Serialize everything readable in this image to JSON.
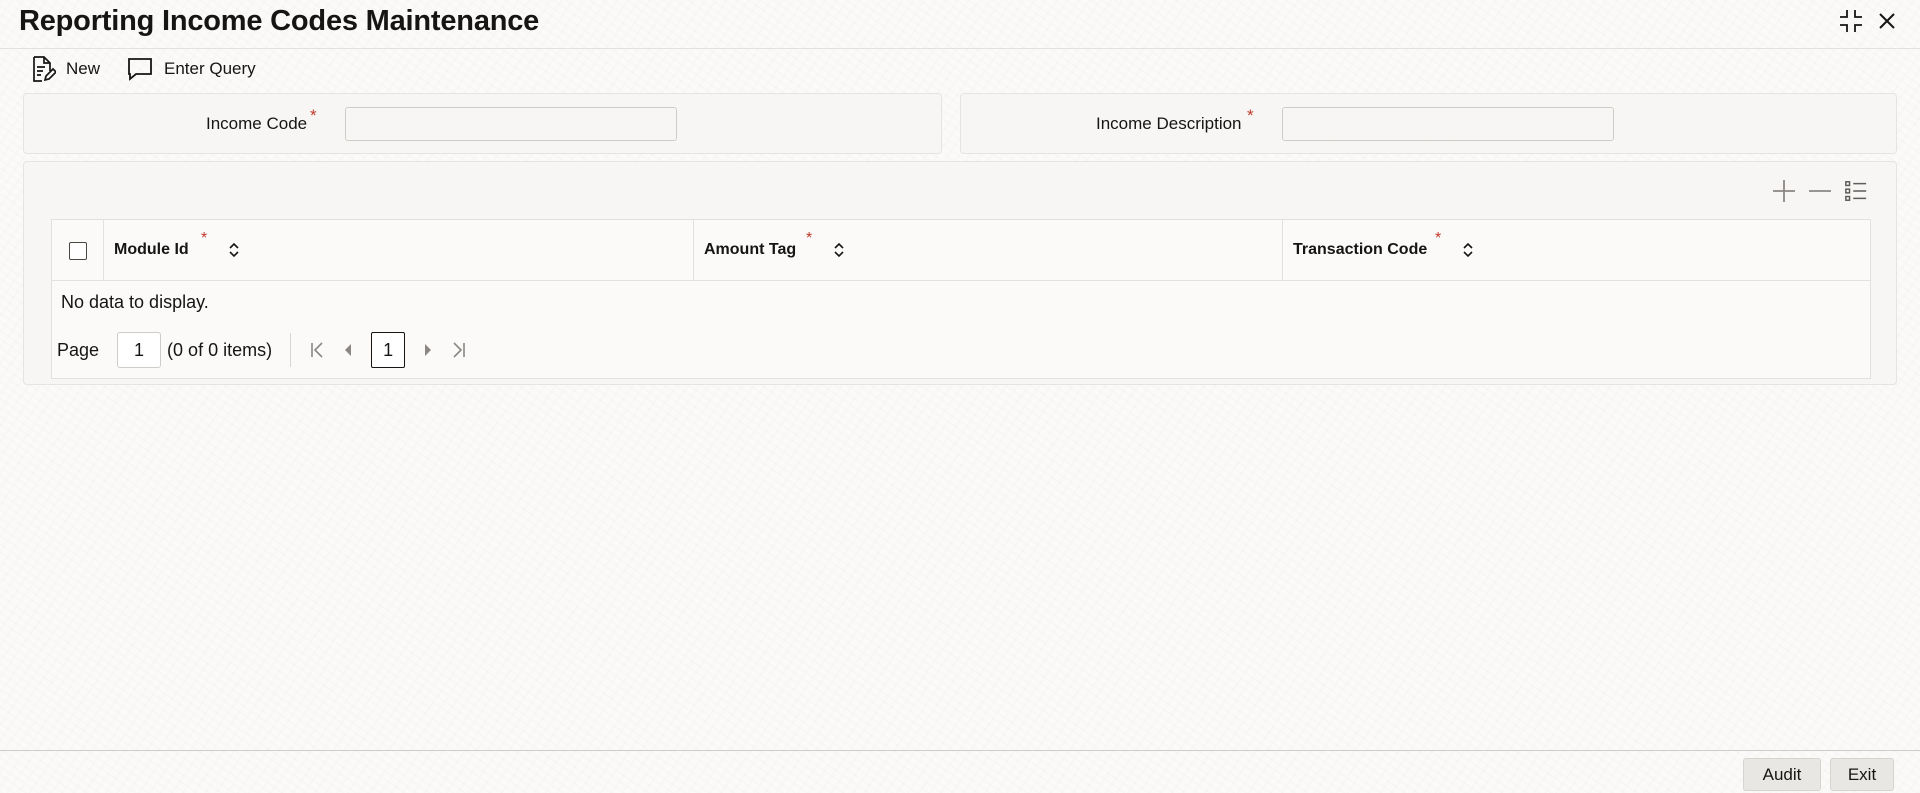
{
  "window": {
    "title": "Reporting Income Codes Maintenance"
  },
  "toolbar": {
    "new_label": "New",
    "enter_query_label": "Enter Query"
  },
  "form": {
    "income_code": {
      "label": "Income Code",
      "required_mark": "*",
      "value": ""
    },
    "income_description": {
      "label": "Income Description",
      "required_mark": "*",
      "value": ""
    }
  },
  "grid": {
    "columns": [
      {
        "label": "Module Id",
        "required_mark": "*"
      },
      {
        "label": "Amount Tag",
        "required_mark": "*"
      },
      {
        "label": "Transaction Code",
        "required_mark": "*"
      }
    ],
    "empty_message": "No data to display.",
    "pagination": {
      "page_label": "Page",
      "page_value": "1",
      "items_summary": "(0 of 0 items)",
      "current_page": "1"
    }
  },
  "footer": {
    "audit_label": "Audit",
    "exit_label": "Exit"
  },
  "colors": {
    "required": "#c0392b",
    "text": "#161513",
    "background": "#fbfaf9"
  },
  "icons": {
    "maximize": "compress-icon",
    "close": "close-icon",
    "new": "new-document-icon",
    "enter_query": "chat-bubble-icon",
    "add_row": "plus-icon",
    "delete_row": "minus-icon",
    "single_view": "list-icon",
    "sort": "sort-icon",
    "first_page": "first-page-icon",
    "prev_page": "prev-page-icon",
    "next_page": "next-page-icon",
    "last_page": "last-page-icon"
  }
}
